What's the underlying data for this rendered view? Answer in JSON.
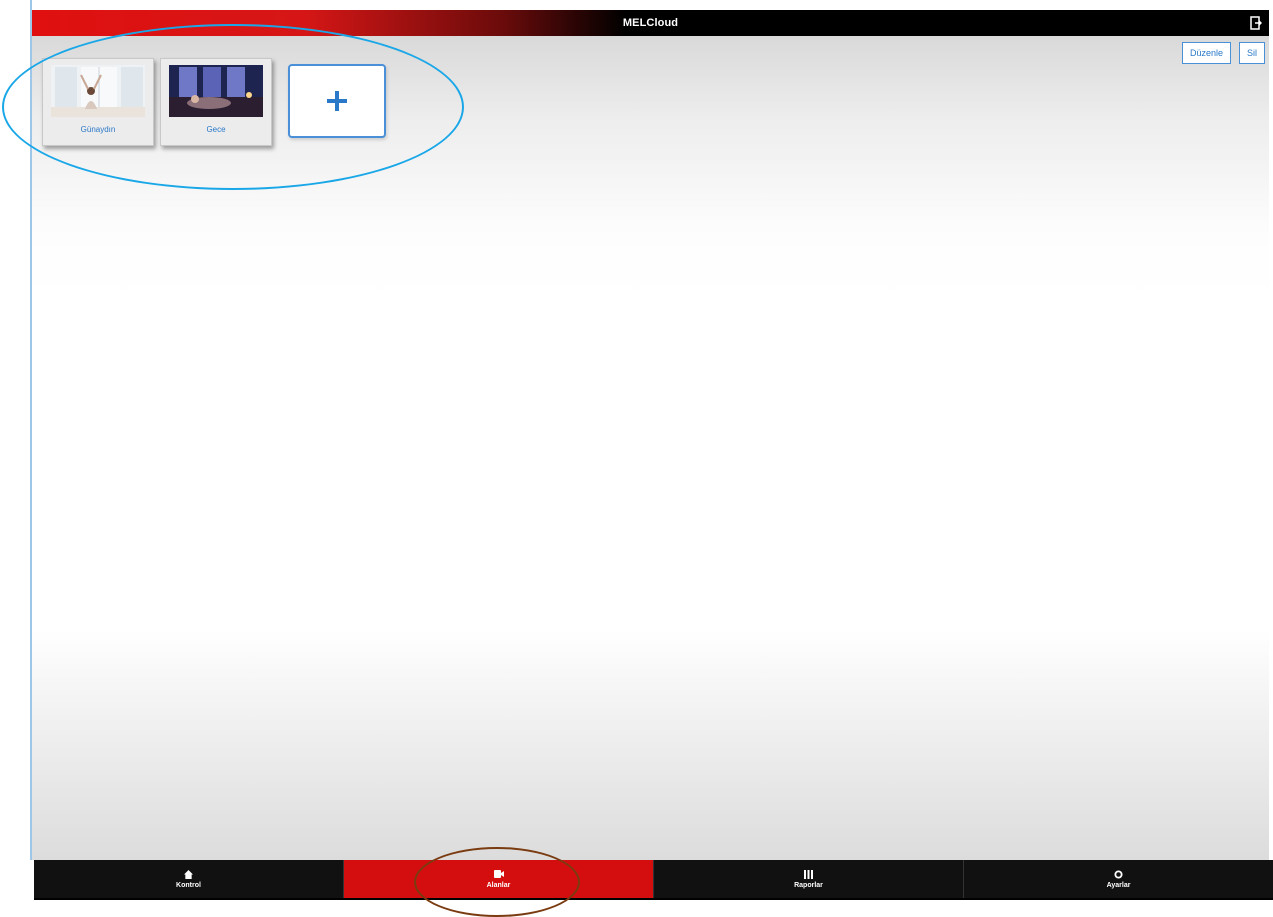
{
  "app": {
    "title": "MELCloud"
  },
  "top_actions": {
    "edit_label": "Düzenle",
    "delete_label": "Sil"
  },
  "scenes": [
    {
      "label": "Günaydın",
      "icon": "morning-photo"
    },
    {
      "label": "Gece",
      "icon": "night-photo"
    }
  ],
  "add_scene": {
    "icon": "plus-icon"
  },
  "nav": {
    "tabs": [
      {
        "label": "Kontrol",
        "icon": "home-icon",
        "active": false
      },
      {
        "label": "Alanlar",
        "icon": "camera-icon",
        "active": true
      },
      {
        "label": "Raporlar",
        "icon": "grid-icon",
        "active": false
      },
      {
        "label": "Ayarlar",
        "icon": "circle-icon",
        "active": false
      }
    ]
  },
  "colors": {
    "header_red": "#e01010",
    "accent_blue": "#2a78c8",
    "active_tab": "#d40e0e",
    "annotation_blue": "#1aa7e8",
    "annotation_brown": "#7a3b10"
  }
}
